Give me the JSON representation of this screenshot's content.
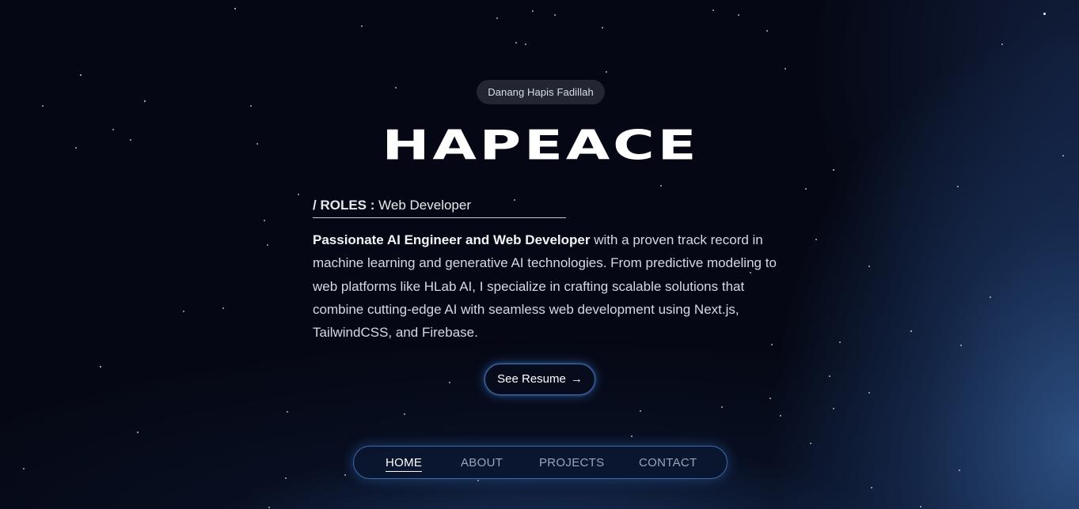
{
  "hero": {
    "owner_name": "Danang Hapis Fadillah",
    "brand": "HAPEACE",
    "roles_label": "/ ROLES :",
    "role_value": "Web Developer",
    "bio_lead": "Passionate AI Engineer and Web Developer",
    "bio_rest": " with a proven track record in machine learning and generative AI technologies. From predictive modeling to web platforms like HLab AI, I specialize in crafting scalable solutions that combine cutting-edge AI with seamless web development using Next.js, TailwindCSS, and Firebase.",
    "resume_button": "See Resume",
    "resume_icon": "arrow-right-icon"
  },
  "nav": {
    "items": [
      {
        "label": "HOME",
        "active": true
      },
      {
        "label": "ABOUT",
        "active": false
      },
      {
        "label": "PROJECTS",
        "active": false
      },
      {
        "label": "CONTACT",
        "active": false
      }
    ]
  },
  "colors": {
    "background": "#050814",
    "accent_glow": "#3f6fae",
    "text_primary": "#ffffff",
    "text_muted": "#9aa4b8"
  }
}
